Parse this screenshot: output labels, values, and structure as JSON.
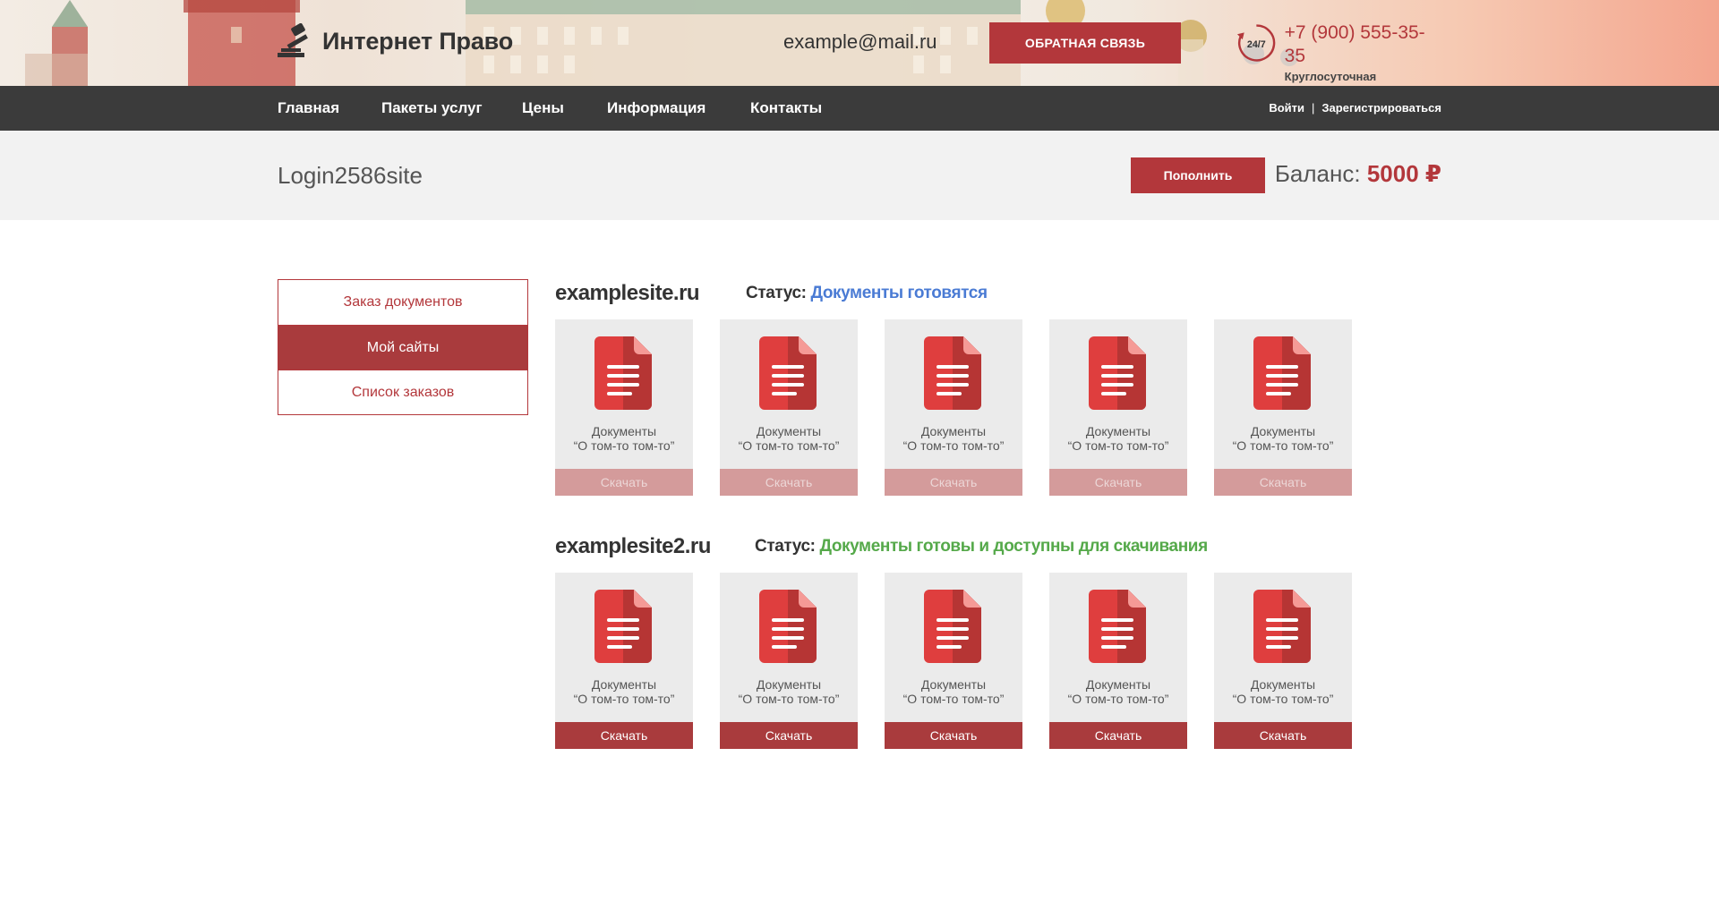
{
  "header": {
    "logo_text": "Интернет Право",
    "email": "example@mail.ru",
    "feedback_label": "Обратная связь",
    "support_badge": "24/7",
    "phone": "+7 (900) 555-35-35",
    "support_text": "Круглосуточная поддержка"
  },
  "nav": {
    "items": [
      {
        "label": "Главная"
      },
      {
        "label": "Пакеты услуг"
      },
      {
        "label": "Цены"
      },
      {
        "label": "Информация"
      },
      {
        "label": "Контакты"
      }
    ],
    "login_label": "Войти",
    "separator": "|",
    "register_label": "Зарегистрироваться"
  },
  "user": {
    "login": "Login2586site",
    "topup_label": "Пополнить",
    "balance_label": "Баланс:",
    "balance_value": "5000 ₽"
  },
  "sidebar": {
    "items": [
      {
        "label": "Заказ документов",
        "active": false
      },
      {
        "label": "Мой сайты",
        "active": true
      },
      {
        "label": "Список заказов",
        "active": false
      }
    ]
  },
  "sites": [
    {
      "name": "examplesite.ru",
      "status_label": "Статус:",
      "status_text": "Документы готовятся",
      "status_color": "#4a7bd4",
      "cards": [
        {
          "line1": "Документы",
          "line2": "“О том-то том-то”",
          "button": "Скачать",
          "enabled": false
        },
        {
          "line1": "Документы",
          "line2": "“О том-то том-то”",
          "button": "Скачать",
          "enabled": false
        },
        {
          "line1": "Документы",
          "line2": "“О том-то том-то”",
          "button": "Скачать",
          "enabled": false
        },
        {
          "line1": "Документы",
          "line2": "“О том-то том-то”",
          "button": "Скачать",
          "enabled": false
        },
        {
          "line1": "Документы",
          "line2": "“О том-то том-то”",
          "button": "Скачать",
          "enabled": false
        }
      ]
    },
    {
      "name": "examplesite2.ru",
      "status_label": "Статус:",
      "status_text": "Документы готовы и доступны для скачивания",
      "status_color": "#55a94a",
      "cards": [
        {
          "line1": "Документы",
          "line2": "“О том-то том-то”",
          "button": "Скачать",
          "enabled": true
        },
        {
          "line1": "Документы",
          "line2": "“О том-то том-то”",
          "button": "Скачать",
          "enabled": true
        },
        {
          "line1": "Документы",
          "line2": "“О том-то том-то”",
          "button": "Скачать",
          "enabled": true
        },
        {
          "line1": "Документы",
          "line2": "“О том-то том-то”",
          "button": "Скачать",
          "enabled": true
        },
        {
          "line1": "Документы",
          "line2": "“О том-то том-то”",
          "button": "Скачать",
          "enabled": true
        }
      ]
    }
  ],
  "icons": {
    "logo": "gavel-icon",
    "support": "clock-24-7-icon",
    "document": "document-icon"
  },
  "colors": {
    "accent": "#b3373b",
    "nav_bg": "#3b3b3b",
    "status_preparing": "#4a7bd4",
    "status_ready": "#55a94a"
  }
}
